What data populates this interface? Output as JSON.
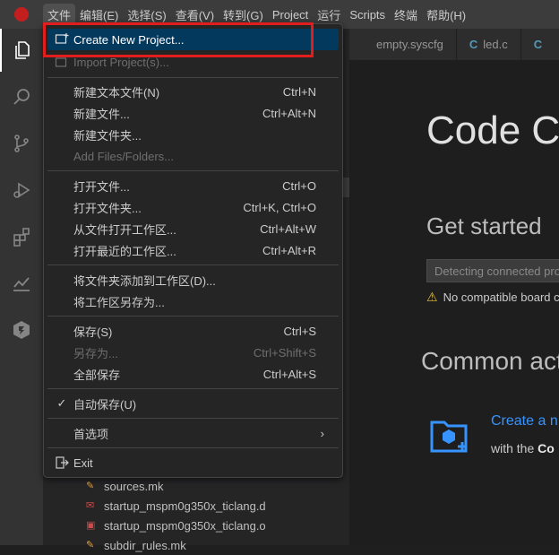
{
  "menubar": {
    "items": [
      "文件",
      "编辑(E)",
      "选择(S)",
      "查看(V)",
      "转到(G)",
      "Project",
      "运行",
      "Scripts",
      "终端",
      "帮助(H)"
    ]
  },
  "tabs": [
    {
      "label": "empty.syscfg"
    },
    {
      "label": "led.c"
    }
  ],
  "file_menu": {
    "create_new_project": "Create New Project...",
    "import_project": "Import Project(s)...",
    "new_text_file": {
      "label": "新建文本文件(N)",
      "key": "Ctrl+N"
    },
    "new_file": {
      "label": "新建文件...",
      "key": "Ctrl+Alt+N"
    },
    "new_folder": {
      "label": "新建文件夹..."
    },
    "add_files": {
      "label": "Add Files/Folders..."
    },
    "open_file": {
      "label": "打开文件...",
      "key": "Ctrl+O"
    },
    "open_folder": {
      "label": "打开文件夹...",
      "key": "Ctrl+K, Ctrl+O"
    },
    "open_workspace_from_file": {
      "label": "从文件打开工作区...",
      "key": "Ctrl+Alt+W"
    },
    "open_recent_workspace": {
      "label": "打开最近的工作区...",
      "key": "Ctrl+Alt+R"
    },
    "add_folder_to_workspace": {
      "label": "将文件夹添加到工作区(D)..."
    },
    "save_workspace_as": {
      "label": "将工作区另存为..."
    },
    "save": {
      "label": "保存(S)",
      "key": "Ctrl+S"
    },
    "save_as": {
      "label": "另存为...",
      "key": "Ctrl+Shift+S"
    },
    "save_all": {
      "label": "全部保存",
      "key": "Ctrl+Alt+S"
    },
    "auto_save": {
      "label": "自动保存(U)",
      "checked": true
    },
    "preferences": {
      "label": "首选项"
    },
    "exit": {
      "label": "Exit"
    }
  },
  "explorer": {
    "files": [
      {
        "name": "sources.mk",
        "type": "mk"
      },
      {
        "name": "startup_mspm0g350x_ticlang.d",
        "type": "d"
      },
      {
        "name": "startup_mspm0g350x_ticlang.o",
        "type": "o"
      },
      {
        "name": "subdir_rules.mk",
        "type": "mk"
      }
    ]
  },
  "welcome": {
    "title": "Code C",
    "get_started": "Get started",
    "detect_placeholder": "Detecting connected pro",
    "warning": "No compatible board c",
    "common_actions": "Common act",
    "create_link": "Create a n",
    "create_desc_prefix": "with the ",
    "create_desc_bold": "Co"
  },
  "colors": {
    "highlight": "#04395e",
    "annotation_box": "#e11d1d",
    "link": "#3794ff",
    "warning": "#e2c041"
  }
}
